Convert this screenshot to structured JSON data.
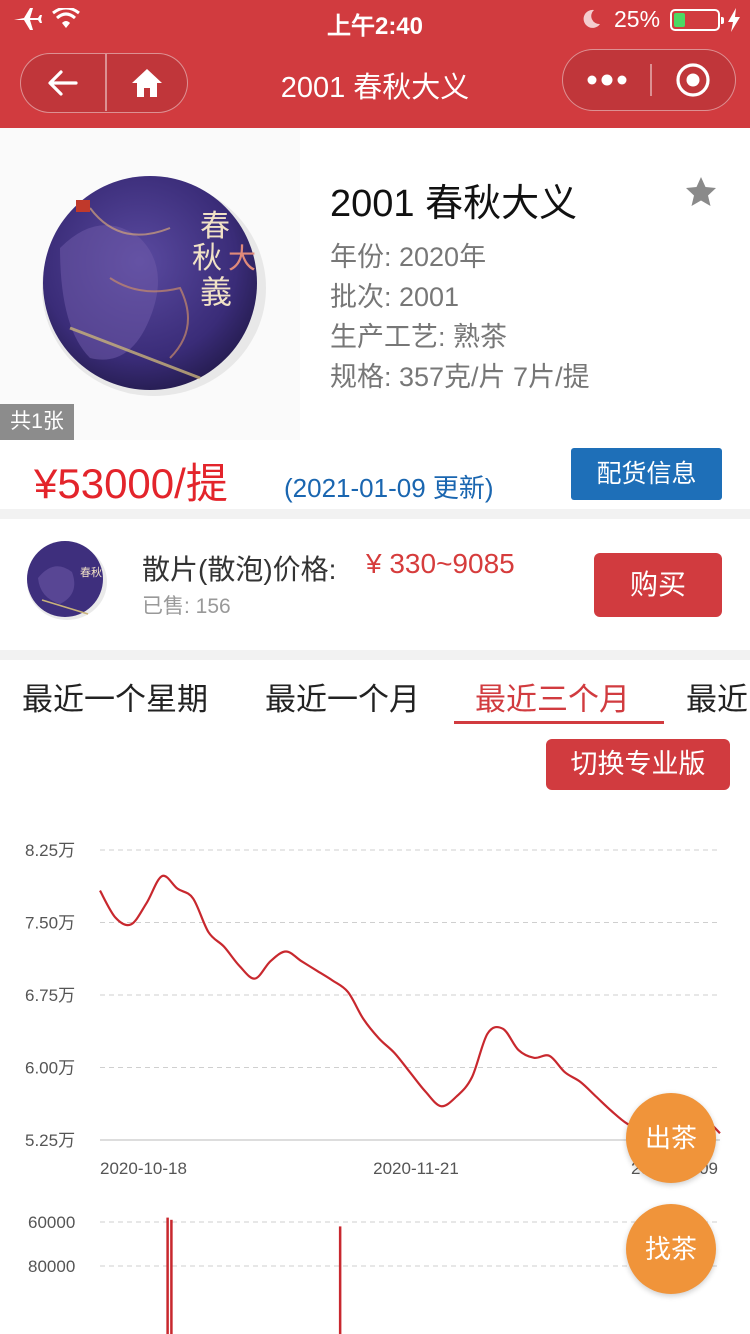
{
  "status_bar": {
    "time": "上午2:40",
    "battery": "25%",
    "battery_level": 0.25
  },
  "title_bar": {
    "title": "2001 春秋大义"
  },
  "product": {
    "image_count": "共1张",
    "title": "2001 春秋大义",
    "attributes": [
      "年份: 2020年",
      "批次: 2001",
      "生产工艺: 熟茶",
      "规格: 357克/片 7片/提"
    ],
    "price": "¥53000/提",
    "update_note": "(2021-01-09 更新)",
    "delivery_button": "配货信息"
  },
  "loose": {
    "label": "散片(散泡)价格:",
    "price": "¥ 330~9085",
    "sold": "已售: 156",
    "buy_button": "购买"
  },
  "tabs": [
    {
      "label": "最近一个星期",
      "active": false
    },
    {
      "label": "最近一个月",
      "active": false
    },
    {
      "label": "最近三个月",
      "active": true
    },
    {
      "label": "最近",
      "active": false
    }
  ],
  "pro_button": "切换专业版",
  "fab": {
    "sell": "出茶",
    "find": "找茶"
  },
  "chart_data": [
    {
      "type": "line",
      "y_ticks": [
        "8.25万",
        "7.50万",
        "6.75万",
        "6.00万",
        "5.25万"
      ],
      "y_tick_values": [
        82500,
        75000,
        67500,
        60000,
        52500
      ],
      "x_ticks": [
        "2020-10-18",
        "2020-11-21",
        "2021-01-09"
      ],
      "ylim": [
        52500,
        82500
      ],
      "grid": true,
      "color": "#c8282e",
      "series": [
        {
          "values": [
            78300,
            75500,
            74800,
            77000,
            79800,
            78500,
            77500,
            74000,
            72500,
            70500,
            69200,
            71000,
            72000,
            71000,
            70000,
            69000,
            67800,
            65000,
            63000,
            61500,
            59500,
            57500,
            56000,
            57000,
            59000,
            63500,
            64000,
            61800,
            61000,
            61200,
            59500,
            58500,
            57000,
            55500,
            54200,
            53500,
            53800,
            54500,
            55000,
            54700,
            53200
          ]
        }
      ]
    },
    {
      "type": "bar",
      "y_ticks": [
        "80000",
        "60000"
      ],
      "y_tick_values": [
        80000,
        60000
      ],
      "grid": true,
      "color": "#c8282e",
      "bars": [
        {
          "x_index": 0.35,
          "value": 58000
        },
        {
          "x_index": 0.37,
          "value": 59000
        },
        {
          "x_index": 1.26,
          "value": 62000
        }
      ]
    }
  ]
}
